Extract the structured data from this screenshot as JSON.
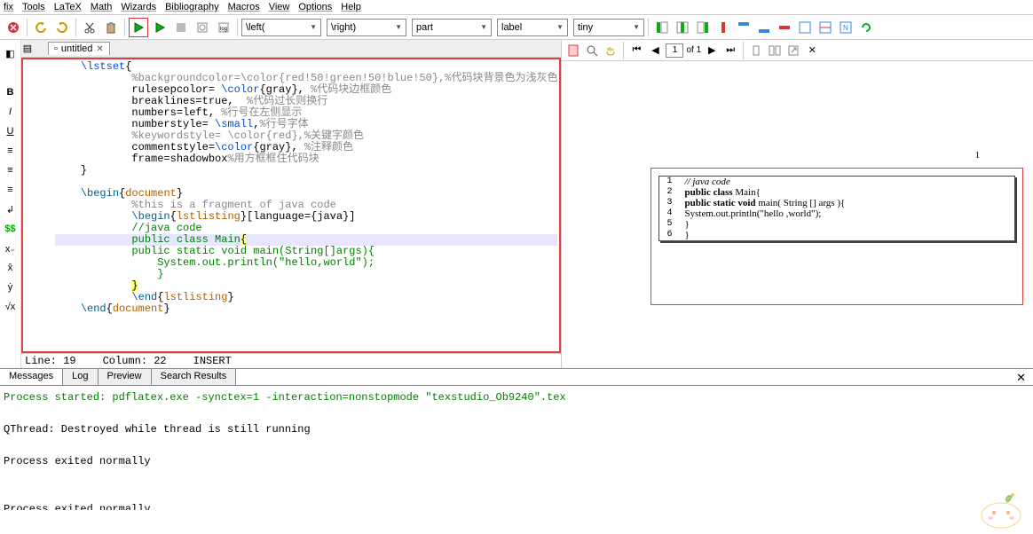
{
  "menu": [
    "fix",
    "Tools",
    "LaTeX",
    "Math",
    "Wizards",
    "Bibliography",
    "Macros",
    "View",
    "Options",
    "Help"
  ],
  "toolbar": {
    "dd": [
      {
        "label": "\\left(",
        "w": 90
      },
      {
        "label": "\\right)",
        "w": 90
      },
      {
        "label": "part",
        "w": 90
      },
      {
        "label": "label",
        "w": 80
      },
      {
        "label": "tiny",
        "w": 80
      }
    ]
  },
  "tab": {
    "title": "untitled"
  },
  "leftbar": [
    "◧",
    "",
    "B",
    "I",
    "U",
    "≡",
    "≡",
    "≡",
    "↲",
    "$$",
    "x₋",
    "x̂",
    "ẏ",
    "√x"
  ],
  "editor": {
    "lines": [
      {
        "indent": 1,
        "seg": [
          {
            "t": "\\lstset",
            "c": "kw-blue"
          },
          {
            "t": "{"
          }
        ]
      },
      {
        "indent": 3,
        "seg": [
          {
            "t": "%backgroundcolor=\\color{red!50!green!50!blue!50},%代码块背景色为浅灰色",
            "c": "kw-gray"
          }
        ]
      },
      {
        "indent": 3,
        "seg": [
          {
            "t": "rulesepcolor= "
          },
          {
            "t": "\\color",
            "c": "kw-blue"
          },
          {
            "t": "{gray}, "
          },
          {
            "t": "%代码块边框颜色",
            "c": "kw-gray"
          }
        ]
      },
      {
        "indent": 3,
        "seg": [
          {
            "t": "breaklines=true,  "
          },
          {
            "t": "%代码过长则换行",
            "c": "kw-gray"
          }
        ]
      },
      {
        "indent": 3,
        "seg": [
          {
            "t": "numbers=left, "
          },
          {
            "t": "%行号在左侧显示",
            "c": "kw-gray"
          }
        ]
      },
      {
        "indent": 3,
        "seg": [
          {
            "t": "numberstyle= "
          },
          {
            "t": "\\small",
            "c": "kw-blue"
          },
          {
            "t": ","
          },
          {
            "t": "%行号字体",
            "c": "kw-gray"
          }
        ]
      },
      {
        "indent": 3,
        "seg": [
          {
            "t": "%keywordstyle= \\color{red},%关键字颜色",
            "c": "kw-gray"
          }
        ]
      },
      {
        "indent": 3,
        "seg": [
          {
            "t": "commentstyle="
          },
          {
            "t": "\\color",
            "c": "kw-blue"
          },
          {
            "t": "{gray}, "
          },
          {
            "t": "%注释颜色",
            "c": "kw-gray"
          }
        ]
      },
      {
        "indent": 3,
        "seg": [
          {
            "t": "frame=shadowbox"
          },
          {
            "t": "%用方框框住代码块",
            "c": "kw-gray"
          }
        ]
      },
      {
        "indent": 1,
        "seg": [
          {
            "t": "}"
          }
        ]
      },
      {
        "indent": 1,
        "seg": [
          {
            "t": ""
          }
        ]
      },
      {
        "indent": 1,
        "seg": [
          {
            "t": "\\begin",
            "c": "kw-teal"
          },
          {
            "t": "{"
          },
          {
            "t": "document",
            "c": "kw-orange"
          },
          {
            "t": "}"
          }
        ]
      },
      {
        "indent": 3,
        "seg": [
          {
            "t": "%this is a fragment of java code",
            "c": "kw-gray"
          }
        ]
      },
      {
        "indent": 3,
        "seg": [
          {
            "t": "\\begin",
            "c": "kw-teal"
          },
          {
            "t": "{"
          },
          {
            "t": "lstlisting",
            "c": "kw-orange"
          },
          {
            "t": "}[language={java}]"
          }
        ]
      },
      {
        "indent": 3,
        "seg": [
          {
            "t": "//java code",
            "c": "kw-green"
          }
        ]
      },
      {
        "indent": 3,
        "hl": true,
        "seg": [
          {
            "t": "public class ",
            "c": "kw-green"
          },
          {
            "t": "Main",
            "c": "kw-green"
          },
          {
            "t": "{",
            "c": "bracket-y"
          }
        ]
      },
      {
        "indent": 3,
        "seg": [
          {
            "t": "public static void main(String[]args){",
            "c": "kw-green"
          }
        ]
      },
      {
        "indent": 4,
        "seg": [
          {
            "t": "System.out.println(\"hello,world\");",
            "c": "kw-green"
          }
        ]
      },
      {
        "indent": 4,
        "seg": [
          {
            "t": "}",
            "c": "kw-green"
          }
        ]
      },
      {
        "indent": 3,
        "seg": [
          {
            "t": "}",
            "c": "bracket-y"
          }
        ]
      },
      {
        "indent": 3,
        "seg": [
          {
            "t": "\\end",
            "c": "kw-teal"
          },
          {
            "t": "{"
          },
          {
            "t": "lstlisting",
            "c": "kw-orange"
          },
          {
            "t": "}"
          }
        ]
      },
      {
        "indent": 1,
        "seg": [
          {
            "t": "\\end",
            "c": "kw-teal"
          },
          {
            "t": "{"
          },
          {
            "t": "document",
            "c": "kw-orange"
          },
          {
            "t": "}"
          }
        ]
      }
    ],
    "status": {
      "line": "Line: 19",
      "col": "Column: 22",
      "mode": "INSERT"
    }
  },
  "viewer": {
    "page_of": "of 1",
    "page_cur": "1",
    "page_number_corner": "1",
    "listing": [
      {
        "n": "1",
        "code": [
          {
            "t": "// java code",
            "it": true
          }
        ]
      },
      {
        "n": "2",
        "code": [
          {
            "t": "public class ",
            "kw": true
          },
          {
            "t": "Main{"
          }
        ]
      },
      {
        "n": "3",
        "code": [
          {
            "t": "public static void ",
            "kw": true
          },
          {
            "t": "main( String [] args ){"
          }
        ]
      },
      {
        "n": "4",
        "code": [
          {
            "t": "    System.out.println(\"hello ,world\");"
          }
        ]
      },
      {
        "n": "5",
        "code": [
          {
            "t": "    }"
          }
        ]
      },
      {
        "n": "6",
        "code": [
          {
            "t": "}"
          }
        ]
      }
    ]
  },
  "bottom_tabs": [
    "Messages",
    "Log",
    "Preview",
    "Search Results"
  ],
  "messages": [
    {
      "t": "Process started: pdflatex.exe -synctex=1 -interaction=nonstopmode \"texstudio_Ob9240\".tex",
      "c": "msg-green"
    },
    {
      "t": ""
    },
    {
      "t": "QThread: Destroyed while thread is still running"
    },
    {
      "t": ""
    },
    {
      "t": "Process exited normally"
    },
    {
      "t": ""
    },
    {
      "t": ""
    },
    {
      "t": "Process exited normally"
    }
  ]
}
